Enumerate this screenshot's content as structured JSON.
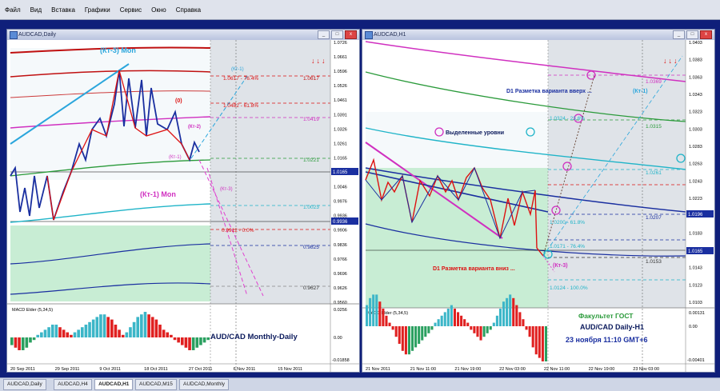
{
  "menu": [
    "Файл",
    "Вид",
    "Вставка",
    "Графики",
    "Сервис",
    "Окно",
    "Справка"
  ],
  "left_window": {
    "title": "AUDCAD,Daily",
    "labels": {
      "kt3_mon": "(Кт-3) Mon",
      "kt1_mon": "(Кт-1) Mon",
      "kt1": "(Кт-1)",
      "kt1_b": "(Кт-1)",
      "kt2": "(Кт-2)",
      "kt3": "(Кт-3)",
      "zero": "(0)",
      "fib_764": "1.0617 - 76.4%",
      "fib_618": "1.0482 - 61.8%",
      "fib_0": "0.9912 - 0.0%",
      "lvl_10617": "1.0617",
      "lvl_10419": "1.0419",
      "lvl_10221": "1.0221",
      "lvl_10023": "1.0023",
      "lvl_09825": "0.9825",
      "lvl_09627": "0.9627",
      "watermark": "AUD/CAD Monthly-Daily"
    },
    "axis": [
      "1.0726",
      "1.0661",
      "1.0596",
      "1.0526",
      "1.0461",
      "1.0391",
      "1.0326",
      "1.0261",
      "1.0165",
      "1.0121",
      "1.0046",
      "0.9976",
      "0.9936",
      "0.9906",
      "0.9836",
      "0.9766",
      "0.9696",
      "0.9626",
      "0.9560"
    ],
    "price_tag": "1.0165",
    "price_tag2": "0.9936",
    "macd_title": "MACD Elder (5,34,5)",
    "macd_axis": [
      "0.0256",
      "0.00",
      "-0.01858"
    ],
    "dates": [
      "20 Sep 2011",
      "29 Sep 2011",
      "9 Oct 2011",
      "18 Oct 2011",
      "27 Oct 2011",
      "6 Nov 2011",
      "15 Nov 2011"
    ]
  },
  "right_window": {
    "title": "AUDCAD,H1",
    "labels": {
      "d1_up": "D1 Разметка варианта вверх ...",
      "kt1": "(Кт-1)",
      "selected_levels": "Выделенные уровни",
      "d1_down": "D1 Разметка варианта вниз ...",
      "kt3": "(Кт-3)",
      "lvl_10369": "1.0369",
      "lvl_10315": "1.0315",
      "lvl_10261": "1.0261",
      "lvl_10207": "1.0207",
      "lvl_10153": "1.0153",
      "fib_10324": "1.0324 - 23.6%",
      "fib_10200": "1.0200 - 61.8%",
      "fib_10171": "1.0171 - 76.4%",
      "fib_10124": "1.0124 - 100.0%",
      "brand": "Факультет ГОСТ",
      "pair": "AUD/CAD Daily-H1",
      "datetime": "23 ноября 11:10  GMT+6"
    },
    "axis": [
      "1.0403",
      "1.0383",
      "1.0363",
      "1.0343",
      "1.0323",
      "1.0303",
      "1.0283",
      "1.0263",
      "1.0243",
      "1.0223",
      "1.0203",
      "1.0183",
      "1.0163",
      "1.0143",
      "1.0123",
      "1.0103"
    ],
    "price_tag": "1.0165",
    "price_tag2": "1.0196",
    "macd_title": "MACD Elder (5,34,5)",
    "macd_axis": [
      "0.00131",
      "0.00",
      "-0.00401"
    ],
    "dates": [
      "21 Nov 2011",
      "21 Nov 11:00",
      "21 Nov 19:00",
      "22 Nov 03:00",
      "22 Nov 11:00",
      "22 Nov 19:00",
      "23 Nov 03:00"
    ]
  },
  "tabs": [
    "AUDCAD,Daily",
    "AUDCAD,H4",
    "AUDCAD,H1",
    "AUDCAD,M15",
    "AUDCAD,Monthly"
  ],
  "active_tab": "AUDCAD,H1",
  "macd_left": [
    -3,
    -4,
    -5,
    -5,
    -4,
    -2,
    -1,
    1,
    2,
    3,
    4,
    5,
    5,
    4,
    3,
    2,
    1,
    2,
    3,
    4,
    5,
    6,
    7,
    8,
    9,
    9,
    8,
    7,
    5,
    3,
    1,
    2,
    4,
    6,
    8,
    9,
    10,
    9,
    8,
    7,
    5,
    3,
    2,
    1,
    -1,
    -2,
    -3,
    -4,
    -5,
    -5,
    -4,
    -3,
    -2,
    -1
  ],
  "macd_right": [
    6,
    8,
    9,
    9,
    7,
    5,
    3,
    1,
    -1,
    -3,
    -5,
    -7,
    -8,
    -8,
    -7,
    -6,
    -5,
    -4,
    -3,
    -2,
    -1,
    1,
    2,
    3,
    4,
    5,
    6,
    5,
    4,
    3,
    2,
    1,
    -1,
    -2,
    -3,
    -4,
    -3,
    -2,
    -1,
    1,
    3,
    5,
    7,
    8,
    9,
    8,
    6,
    4,
    2,
    -1,
    -3,
    -6,
    -8,
    -9,
    -10,
    -10
  ]
}
